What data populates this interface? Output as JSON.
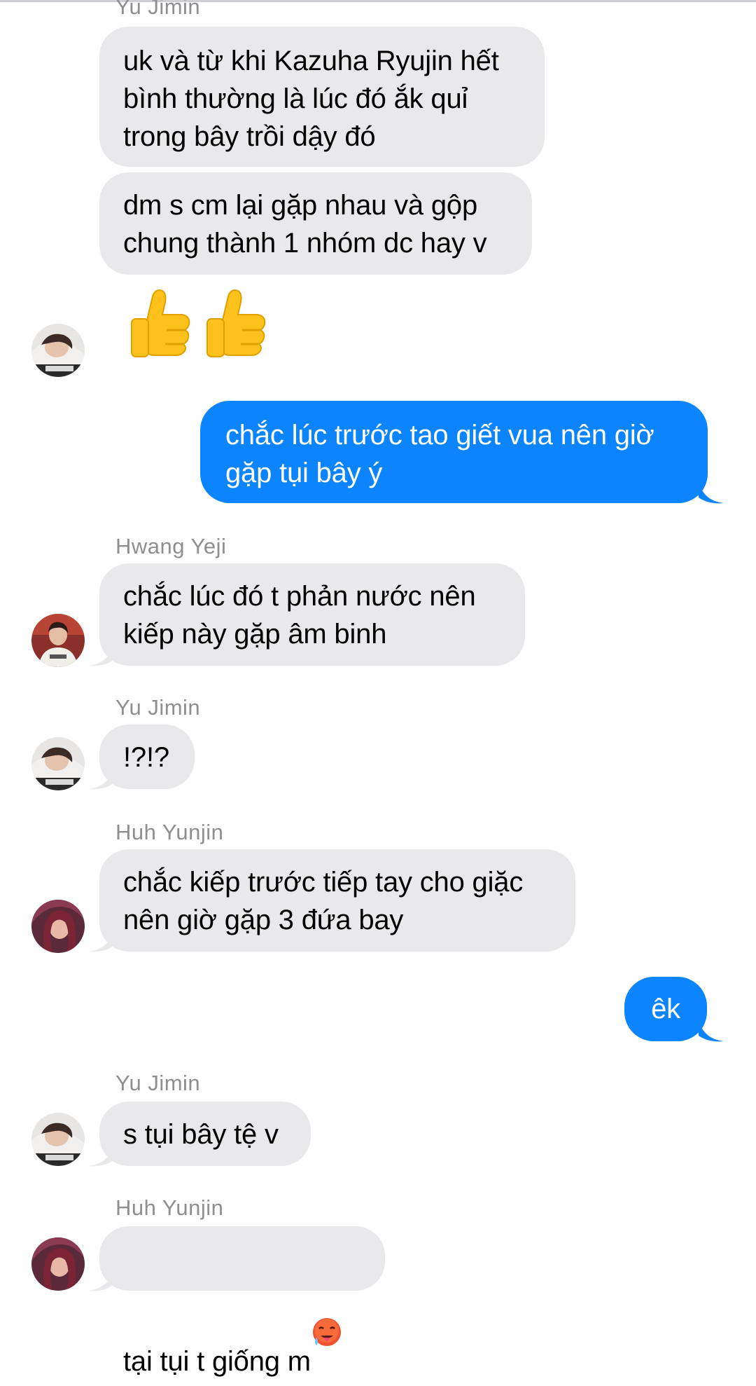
{
  "messages": [
    {
      "sender": "Yu Jimin",
      "text": "uk và từ khi Kazuha Ryujin hết\nbình thường là lúc đó ắk quỉ\ntrong bây trồi dậy đó"
    },
    {
      "text": "dm s cm lại gặp nhau và gộp\nchung thành 1 nhóm dc hay v"
    },
    {
      "emoji": "👍👍",
      "emoji_icon": "thumbs-up-icon"
    },
    {
      "text": "chắc lúc trước tao giết vua nên giờ\ngặp tụi bây ý",
      "outgoing": true
    },
    {
      "sender": "Hwang Yeji",
      "text": "chắc lúc đó t phản nước nên\nkiếp này gặp âm binh"
    },
    {
      "sender": "Yu Jimin",
      "text": "!?!?"
    },
    {
      "sender": "Huh Yunjin",
      "text": "chắc kiếp trước tiếp tay cho giặc\nnên giờ gặp 3 đứa bay"
    },
    {
      "text": "êk",
      "outgoing": true
    },
    {
      "sender": "Yu Jimin",
      "text": "s tụi bây tệ v"
    },
    {
      "sender": "Huh Yunjin",
      "text": "tại tụi t giống m",
      "trailing_emoji": "hot-face-sweat-icon"
    }
  ],
  "colors": {
    "incoming_bubble": "#e9e9eb",
    "outgoing_bubble": "#0b84fe",
    "sender_name": "#8e8e93"
  }
}
